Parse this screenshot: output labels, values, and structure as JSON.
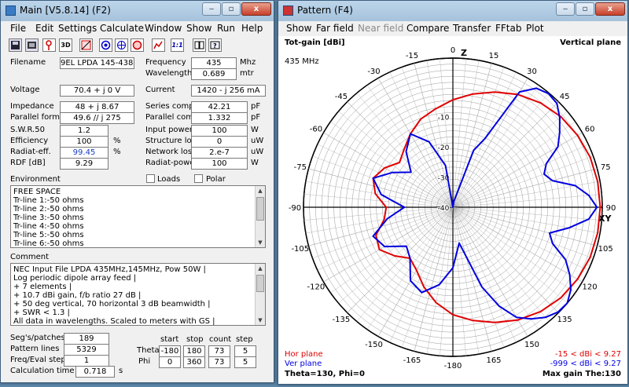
{
  "main_window": {
    "title": "Main [V5.8.14]  (F2)",
    "win_buttons": {
      "minimize": "‒",
      "maximize": "▫",
      "close": "x"
    },
    "menu": [
      "File",
      "Edit",
      "Settings",
      "Calculate",
      "Window",
      "Show",
      "Run",
      "Help"
    ],
    "toolbar_icons": [
      "save-icon",
      "open-icon",
      "wire-icon",
      "3d-view-icon",
      "geometry-edit-icon",
      "far-field-icon",
      "near-field-icon",
      "graph-icon",
      "plot-icon",
      "ratio-icon",
      "book-icon",
      "help-icon"
    ],
    "toolbar_text": {
      "three_d": "3D",
      "ratio": "1:1"
    },
    "fields": {
      "filename_label": "Filename",
      "filename": "9EL LPDA 145-438-V",
      "frequency_label": "Frequency",
      "frequency": "435",
      "frequency_unit": "Mhz",
      "wavelength_label": "Wavelength",
      "wavelength": "0.689",
      "wavelength_unit": "mtr",
      "voltage_label": "Voltage",
      "voltage": "70.4 + j 0 V",
      "current_label": "Current",
      "current": "1420 - j 256 mA",
      "impedance_label": "Impedance",
      "impedance": "48 + j 8.67",
      "parallel_form_label": "Parallel form",
      "parallel_form": "49.6 // j 275",
      "series_comp_label": "Series comp.",
      "series_comp": "42.21",
      "series_comp_unit": "pF",
      "parallel_comp_label": "Parallel comp.",
      "parallel_comp": "1.332",
      "parallel_comp_unit": "pF",
      "swr_label": "S.W.R.50",
      "swr": "1.2",
      "efficiency_label": "Efficiency",
      "efficiency": "100",
      "efficiency_unit": "%",
      "radiat_eff_label": "Radiat-eff.",
      "radiat_eff": "99.45",
      "radiat_eff_unit": "%",
      "rdf_label": "RDF [dB]",
      "rdf": "9.29",
      "input_power_label": "Input power",
      "input_power": "100",
      "input_power_unit": "W",
      "structure_loss_label": "Structure loss",
      "structure_loss": "0",
      "structure_loss_unit": "uW",
      "network_loss_label": "Network loss",
      "network_loss": "2.e-7",
      "network_loss_unit": "uW",
      "radiat_power_label": "Radiat-power",
      "radiat_power": "100",
      "radiat_power_unit": "W"
    },
    "environment_label": "Environment",
    "loads_label": "Loads",
    "polar_label": "Polar",
    "environment_lines": [
      "FREE SPACE",
      "Tr-line  1:-50 ohms",
      "Tr-line  2:-50 ohms",
      "Tr-line  3:-50 ohms",
      "Tr-line  4:-50 ohms",
      "Tr-line  5:-50 ohms",
      "Tr-line  6:-50 ohms"
    ],
    "comment_label": "Comment",
    "comment_lines": [
      "NEC Input File LPDA 435MHz,145MHz, Pow 50W  |",
      "Log periodic dipole array feed                    |",
      "+ 7 elements                                      |",
      "+ 10.7 dBi gain, f/b ratio 27 dB                  |",
      "+ 50 deg vertical, 70 horizontal 3 dB beamwidth |",
      "+ SWR < 1.3                                       |",
      "All data in wavelengths. Scaled to meters with GS |"
    ],
    "bottom": {
      "segs_label": "Seg's/patches",
      "segs": "189",
      "pattern_lines_label": "Pattern lines",
      "pattern_lines": "5329",
      "freq_steps_label": "Freq/Eval steps",
      "freq_steps": "1",
      "calc_time_label": "Calculation time",
      "calc_time": "0.718",
      "calc_time_unit": "s",
      "col_start": "start",
      "col_stop": "stop",
      "col_count": "count",
      "col_step": "step",
      "theta_label": "Theta",
      "theta": [
        "-180",
        "180",
        "73",
        "5"
      ],
      "phi_label": "Phi",
      "phi": [
        "0",
        "360",
        "73",
        "5"
      ]
    }
  },
  "pattern_window": {
    "title": "Pattern    (F4)",
    "win_buttons": {
      "minimize": "‒",
      "maximize": "▫",
      "close": "x"
    },
    "menu": [
      "Show",
      "Far field",
      "Near field",
      "Compare",
      "Transfer",
      "FFtab",
      "Plot"
    ],
    "menu_disabled": [
      false,
      false,
      true,
      false,
      false,
      false,
      false
    ],
    "header_left": "Tot-gain [dBi]",
    "header_right": "Vertical plane",
    "freq": "435 MHz",
    "axis_z": "Z",
    "axis_xy": "XY",
    "hor_plane": "Hor plane",
    "ver_plane": "Ver plane",
    "hor_range": "-15 < dBi < 9.27",
    "ver_range": "-999 < dBi < 9.27",
    "theta_phi": "Theta=130, Phi=0",
    "max_gain": "Max gain The:130",
    "hor_color": "#e00000",
    "ver_color": "#0000e0"
  },
  "chart_data": {
    "type": "polar",
    "angle_labels": [
      "-15",
      "0",
      "15",
      "30",
      "45",
      "60",
      "75",
      "90",
      "105",
      "120",
      "135",
      "150",
      "165",
      "-180",
      "-165",
      "-150",
      "-135",
      "-120",
      "-105",
      "-90",
      "-75",
      "-60",
      "-45",
      "-30"
    ],
    "radial_labels": [
      "-10",
      "-20",
      "-30",
      "-40"
    ],
    "rlim": [
      -40,
      9.27
    ],
    "series": [
      {
        "name": "Hor plane",
        "color": "#e00000",
        "theta_deg": [
          0,
          10,
          20,
          30,
          40,
          50,
          60,
          70,
          80,
          90,
          100,
          110,
          120,
          130,
          140,
          150,
          160,
          170,
          180,
          190,
          200,
          210,
          220,
          230,
          240,
          250,
          260,
          270,
          280,
          290,
          300,
          310,
          320,
          330,
          340,
          350
        ],
        "gain_dbi": [
          -4.5,
          -2,
          0.5,
          3,
          5,
          6.5,
          7.5,
          8.2,
          8.5,
          8.6,
          8.5,
          8.2,
          7.5,
          6.5,
          5,
          3,
          0.5,
          -2,
          -4.5,
          -8,
          -12,
          -16,
          -18,
          -15,
          -12,
          -13,
          -17,
          -18,
          -14,
          -12,
          -14,
          -17,
          -15,
          -12,
          -9,
          -7
        ]
      },
      {
        "name": "Ver plane",
        "color": "#0000e0",
        "theta_deg": [
          0,
          10,
          20,
          25,
          30,
          35,
          40,
          45,
          50,
          55,
          60,
          65,
          70,
          75,
          80,
          85,
          90,
          95,
          100,
          105,
          110,
          115,
          120,
          125,
          130,
          135,
          140,
          145,
          150,
          155,
          160,
          170,
          180,
          190,
          200,
          210,
          220,
          230,
          240,
          250,
          260,
          270,
          280,
          290,
          300,
          310,
          320,
          330,
          340,
          350
        ],
        "gain_dbi": [
          -40,
          -38,
          -20,
          -15,
          4,
          8,
          9,
          8.5,
          6,
          3,
          0,
          -6,
          -8,
          -6,
          1,
          5,
          7.5,
          5,
          -1,
          -7,
          -5,
          1,
          4.5,
          7.5,
          9.27,
          9,
          7.5,
          5,
          2,
          -4,
          -12,
          -28,
          -20,
          -14,
          -10,
          -12,
          -18,
          -20,
          -14,
          -12,
          -18,
          -24,
          -16,
          -12,
          -17,
          -22,
          -16,
          -12,
          -17,
          -26
        ]
      }
    ]
  }
}
